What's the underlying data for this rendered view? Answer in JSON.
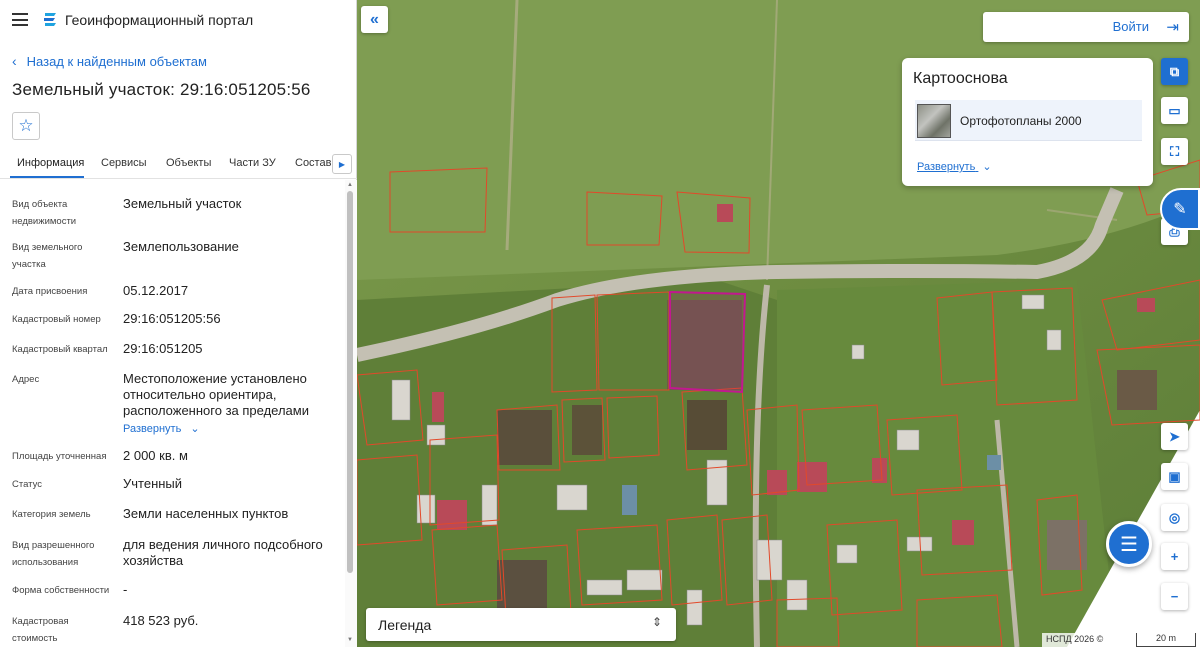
{
  "app": {
    "title": "Геоинформационный портал"
  },
  "nav": {
    "back": "Назад к найденным объектам"
  },
  "object": {
    "title": "Земельный участок: 29:16:051205:56"
  },
  "tabs": [
    "Информация",
    "Сервисы",
    "Объекты",
    "Части ЗУ",
    "Состав"
  ],
  "attributes": [
    {
      "label": "Вид объекта недвижимости",
      "value": "Земельный участок"
    },
    {
      "label": "Вид земельного участка",
      "value": "Землепользование"
    },
    {
      "label": "Дата присвоения",
      "value": "05.12.2017"
    },
    {
      "label": "Кадастровый номер",
      "value": "29:16:051205:56"
    },
    {
      "label": "Кадастровый квартал",
      "value": "29:16:051205"
    },
    {
      "label": "Адрес",
      "value": "Местоположение установлено относительно ориентира, расположенного за пределами"
    },
    {
      "label": "Площадь уточненная",
      "value": "2 000 кв. м"
    },
    {
      "label": "Статус",
      "value": "Учтенный"
    },
    {
      "label": "Категория земель",
      "value": "Земли населенных пунктов"
    },
    {
      "label": "Вид разрешенного использования",
      "value": "для ведения личного подсобного хозяйства"
    },
    {
      "label": "Форма собственности",
      "value": "-"
    },
    {
      "label": "Кадастровая стоимость",
      "value": "418 523 руб."
    }
  ],
  "expand_label": "Развернуть",
  "map": {
    "login": "Войти",
    "basemap_title": "Картооснова",
    "basemap_option": "Ортофотопланы 2000",
    "basemap_expand": "Развернуть",
    "legend": "Легенда",
    "attribution": "НСПД 2026 ©",
    "scale": "20 m"
  },
  "colors": {
    "accent": "#1f6fd1",
    "parcel_border": "#e2492a",
    "selected_parcel": "#c2188f"
  },
  "icons": {
    "menu": "hamburger-icon",
    "logo": "portal-logo-icon",
    "back": "chevron-left-icon",
    "favorite": "star-icon",
    "collapse": "double-chevron-left-icon",
    "login": "login-icon",
    "layers": "layers-icon",
    "measure": "ruler-icon",
    "select": "select-area-icon",
    "print": "print-icon",
    "locate": "navigate-icon",
    "minimap": "minimap-icon",
    "geolocate": "geolocate-icon",
    "zoom_in": "plus-icon",
    "zoom_out": "minus-icon",
    "chat": "chat-icon",
    "side_panel": "side-panel-icon"
  }
}
